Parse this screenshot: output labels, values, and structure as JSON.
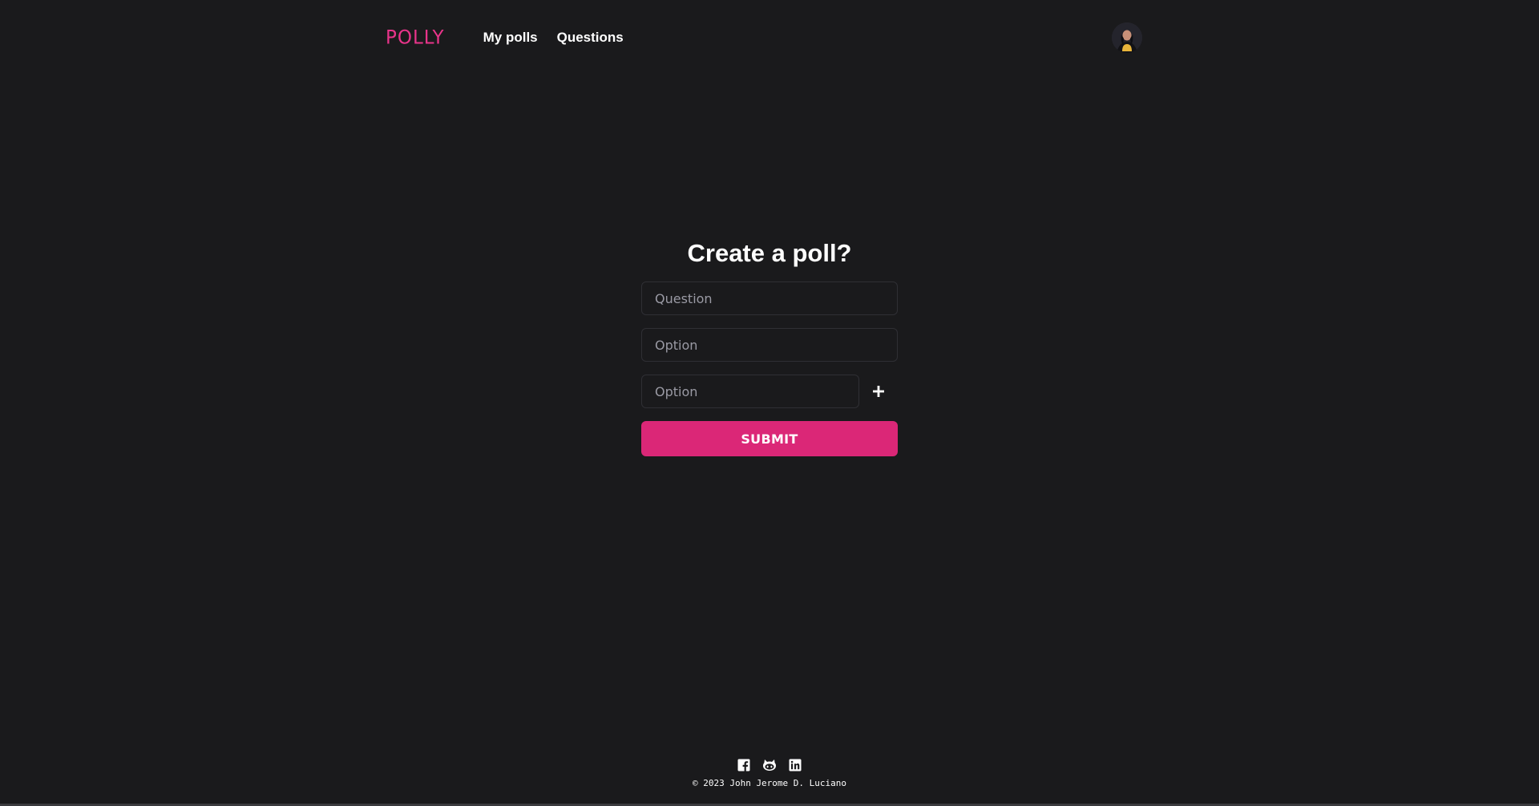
{
  "header": {
    "logo": "POLLY",
    "nav": [
      {
        "label": "My polls"
      },
      {
        "label": "Questions"
      }
    ],
    "avatar_icon": "user-avatar"
  },
  "form": {
    "title": "Create a poll?",
    "question_placeholder": "Question",
    "option_placeholder_1": "Option",
    "option_placeholder_2": "Option",
    "add_icon": "plus-icon",
    "submit_label": "SUBMIT"
  },
  "footer": {
    "social": [
      "facebook-icon",
      "github-icon",
      "linkedin-icon"
    ],
    "copyright": "© 2023 John Jerome D. Luciano"
  },
  "colors": {
    "background": "#1a1a1c",
    "accent": "#db2777",
    "logo": "#e8348a",
    "text": "#ffffff",
    "placeholder": "#9a9aa4"
  }
}
